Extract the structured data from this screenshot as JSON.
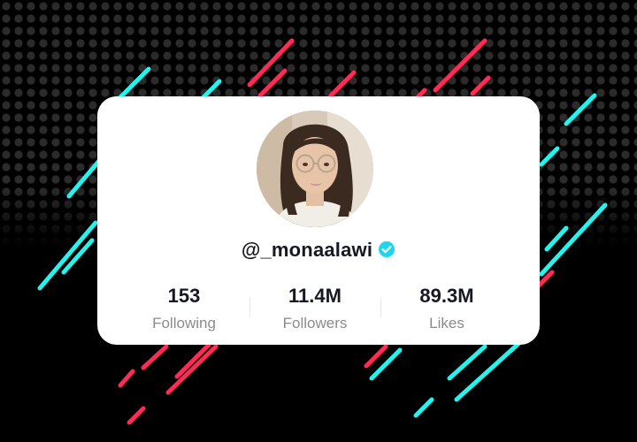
{
  "colors": {
    "background": "#000000",
    "accent_cyan": "#25F4EE",
    "accent_pink": "#FE2C55",
    "verified_badge": "#20D5EC",
    "text_primary": "#161823",
    "text_secondary": "#8A8B91"
  },
  "profile": {
    "username": "@_monaalawi",
    "verified_icon": "verified-check-icon",
    "avatar_icon": "profile-photo"
  },
  "stats": [
    {
      "value": "153",
      "label": "Following"
    },
    {
      "value": "11.4M",
      "label": "Followers"
    },
    {
      "value": "89.3M",
      "label": "Likes"
    }
  ]
}
